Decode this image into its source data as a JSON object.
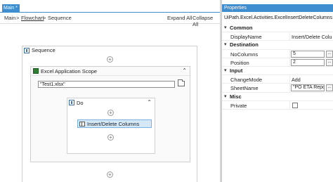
{
  "designer": {
    "tab_label": "Main *",
    "breadcrumb": [
      "Main",
      "Flowchart",
      "Sequence"
    ],
    "breadcrumb_sep": ">",
    "expand_all": "Expand All",
    "collapse_all": "Collapse All",
    "sequence": {
      "title": "Sequence",
      "excel_scope": {
        "title": "Excel Application Scope",
        "workbook_path": "\"Test1.xlsx\"",
        "do_block": {
          "title": "Do",
          "activity": "Insert/Delete Columns"
        }
      }
    }
  },
  "properties": {
    "panel_title": "Properties",
    "activity_type": "UiPath.Excel.Activities.ExcelInsertDeleteColumns",
    "categories": [
      {
        "name": "Common",
        "props": [
          {
            "name": "DisplayName",
            "value": "Insert/Delete Columns",
            "kind": "text"
          }
        ]
      },
      {
        "name": "Destination",
        "props": [
          {
            "name": "NoColumns",
            "value": "5",
            "kind": "input"
          },
          {
            "name": "Position",
            "value": "2",
            "kind": "input"
          }
        ]
      },
      {
        "name": "Input",
        "props": [
          {
            "name": "ChangeMode",
            "value": "Add",
            "kind": "text"
          },
          {
            "name": "SheetName",
            "value": "\"PO ETA Repo",
            "kind": "input"
          }
        ]
      },
      {
        "name": "Misc",
        "props": [
          {
            "name": "Private",
            "value": "",
            "kind": "checkbox"
          }
        ]
      }
    ]
  },
  "colors": {
    "accent": "#3e8ed0",
    "selected_activity": "#d5e8f8"
  }
}
